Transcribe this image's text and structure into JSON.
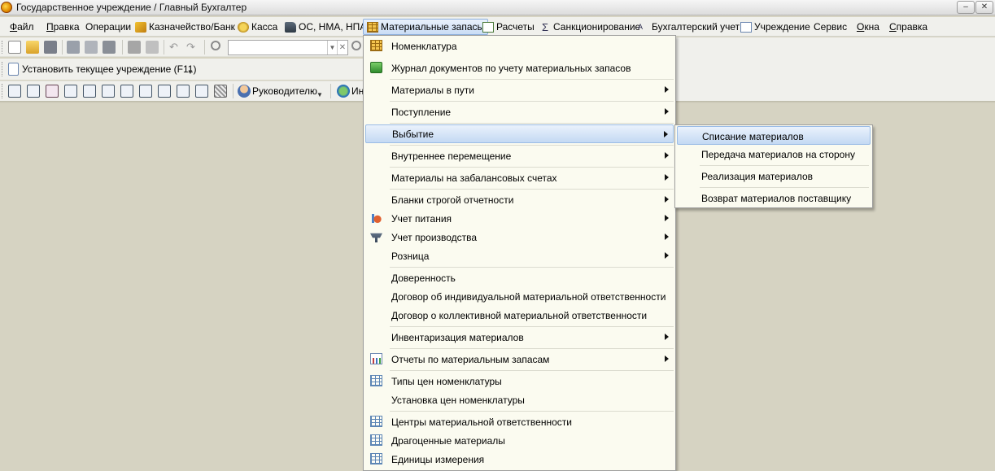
{
  "window": {
    "title": "Государственное учреждение / Главный Бухгалтер",
    "minimize_label": "–",
    "close_label": "✕"
  },
  "menubar": {
    "items": [
      {
        "label": "Файл",
        "underline": "Ф",
        "rest": "айл"
      },
      {
        "label": "Правка",
        "underline": "П",
        "rest": "равка"
      },
      {
        "label": "Операции"
      },
      {
        "label": "Казначейство/Банк",
        "icon": "treasury-icon"
      },
      {
        "label": "Касса",
        "icon": "cash-icon"
      },
      {
        "label": "ОС, НМА, НПА",
        "icon": "truck-icon"
      },
      {
        "label": "Материальные запасы",
        "icon": "materials-icon"
      },
      {
        "label": "Расчеты",
        "icon": "settlements-icon"
      },
      {
        "label": "Санкционирование",
        "icon": "sigma-icon"
      },
      {
        "label": "Бухгалтерский учет",
        "icon": "accounting-icon"
      },
      {
        "label": "Учреждение",
        "icon": "institution-icon"
      },
      {
        "label": "Сервис"
      },
      {
        "label": "Окна",
        "underline": "О",
        "rest": "кна"
      },
      {
        "label": "Справка",
        "underline": "С",
        "rest": "правка"
      }
    ]
  },
  "toolbar": {
    "set_institution_label": "Установить текущее учреждение (F11)",
    "to_manager_label": "Руководителю",
    "info_label_partial": "Ин",
    "search_value": "",
    "search_dropdown_glyph": "▼",
    "search_clear_glyph": "✕",
    "dropdown_arrow_glyph": "▼"
  },
  "dropdown": {
    "items": [
      {
        "label": "Номенклатура",
        "icon": "grid-icon",
        "submenu": false
      },
      {
        "label": "Журнал документов по учету материальных запасов",
        "icon": "journal-icon",
        "submenu": false
      },
      {
        "label": "Материалы в пути",
        "submenu": true
      },
      {
        "label": "Поступление",
        "submenu": true
      },
      {
        "label": "Выбытие",
        "submenu": true,
        "highlighted": true
      },
      {
        "label": "Внутреннее перемещение",
        "submenu": true
      },
      {
        "label": "Материалы на забалансовых счетах",
        "submenu": true
      },
      {
        "label": "Бланки строгой отчетности",
        "submenu": true
      },
      {
        "label": "Учет питания",
        "icon": "food-icon",
        "submenu": true
      },
      {
        "label": "Учет производства",
        "icon": "production-icon",
        "submenu": true
      },
      {
        "label": "Розница",
        "submenu": true
      },
      {
        "label": "Доверенность",
        "submenu": false
      },
      {
        "label": "Договор об индивидуальной материальной ответственности",
        "submenu": false
      },
      {
        "label": "Договор о коллективной материальной ответственности",
        "submenu": false
      },
      {
        "label": "Инвентаризация материалов",
        "submenu": true
      },
      {
        "label": "Отчеты по материальным запасам",
        "icon": "report-icon",
        "submenu": true
      },
      {
        "label": "Типы цен номенклатуры",
        "icon": "grid-icon",
        "submenu": false
      },
      {
        "label": "Установка цен номенклатуры",
        "submenu": false
      },
      {
        "label": "Центры материальной ответственности",
        "icon": "grid-icon",
        "submenu": false
      },
      {
        "label": "Драгоценные материалы",
        "icon": "grid-icon",
        "submenu": false
      },
      {
        "label": "Единицы измерения",
        "icon": "grid-icon",
        "submenu": false
      }
    ]
  },
  "submenu": {
    "items": [
      {
        "label": "Списание материалов",
        "highlighted": true
      },
      {
        "label": "Передача материалов на сторону"
      },
      {
        "label": "Реализация материалов"
      },
      {
        "label": "Возврат материалов поставщику"
      }
    ]
  },
  "colors": {
    "workspace": "#d6d3c2",
    "menu_background": "#fbfbf0",
    "highlight_border": "#9abce6"
  }
}
